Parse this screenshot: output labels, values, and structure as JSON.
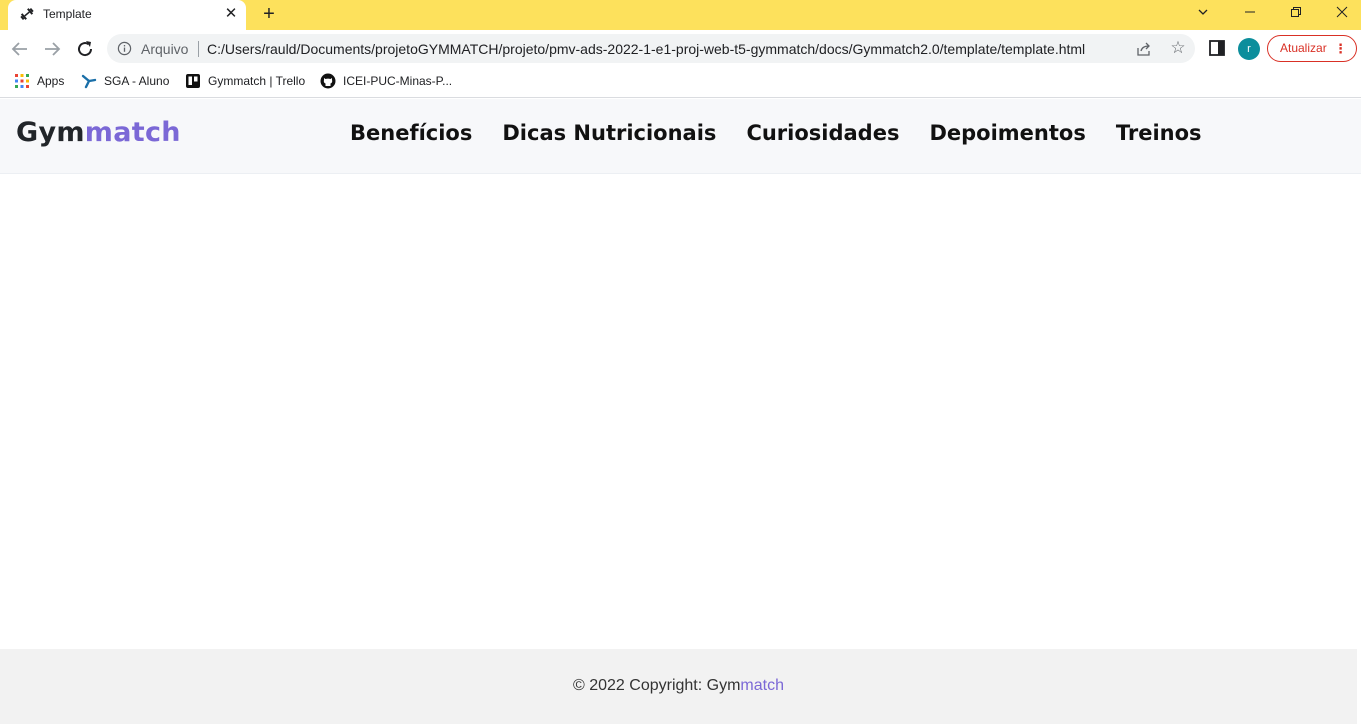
{
  "browser": {
    "tab": {
      "title": "Template"
    },
    "address_bar": {
      "scheme_label": "Arquivo",
      "url": "C:/Users/rauld/Documents/projetoGYMMATCH/projeto/pmv-ads-2022-1-e1-proj-web-t5-gymmatch/docs/Gymmatch2.0/template/template.html"
    },
    "profile_initial": "r",
    "update_button_label": "Atualizar",
    "bookmarks": [
      {
        "label": "Apps",
        "icon": "apps-grid-icon"
      },
      {
        "label": "SGA - Aluno",
        "icon": "sga-icon"
      },
      {
        "label": "Gymmatch | Trello",
        "icon": "trello-icon"
      },
      {
        "label": "ICEI-PUC-Minas-P...",
        "icon": "github-icon"
      }
    ],
    "colors": {
      "tab_strip": "#fde15c",
      "update_accent": "#d93025",
      "avatar": "#0c8e9c"
    }
  },
  "site": {
    "brand": {
      "part1": "Gym",
      "part2": "match"
    },
    "nav": [
      "Benefícios",
      "Dicas Nutricionais",
      "Curiosidades",
      "Depoimentos",
      "Treinos"
    ],
    "footer": {
      "prefix": "© 2022 Copyright: ",
      "brand_part1": "Gym",
      "brand_part2": "match"
    },
    "colors": {
      "brand_accent": "#7b68d6",
      "header_bg": "#f7f8fa",
      "footer_bg": "#f2f2f2"
    }
  }
}
